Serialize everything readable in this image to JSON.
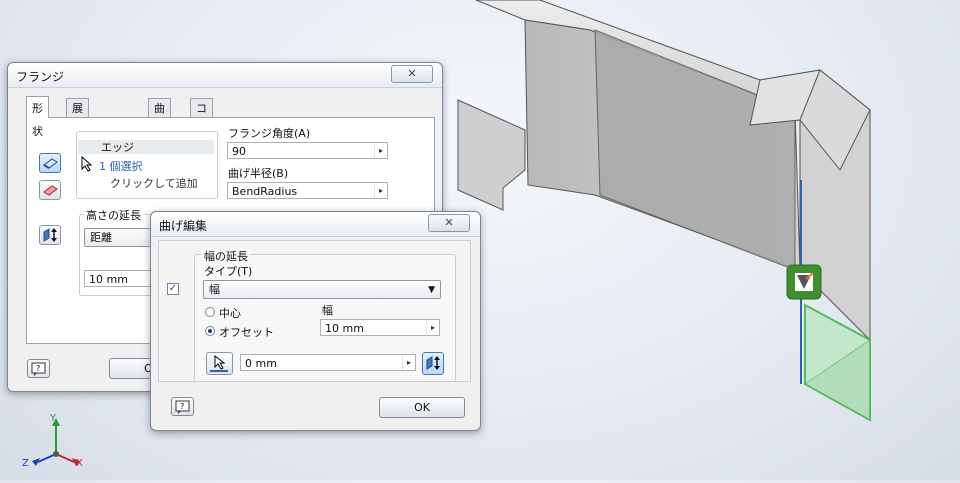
{
  "flange_dialog": {
    "title": "フランジ",
    "close": "✕",
    "tabs": [
      "形状",
      "展開オプション",
      "曲げ",
      "コーナー"
    ],
    "edge_header": "エッジ",
    "edge_selected": "1 個選択",
    "edge_hint": "クリックして追加",
    "angle_label": "フランジ角度(A)",
    "angle_value": "90",
    "radius_label": "曲げ半径(B)",
    "radius_value": "BendRadius",
    "height_extent_label": "高さの延長",
    "height_extent_value": "距離",
    "height_value": "10 mm",
    "ok_partial": "O"
  },
  "bend_dialog": {
    "title": "曲げ編集",
    "close": "✕",
    "width_extent_label": "幅の延長",
    "type_label": "タイプ(T)",
    "type_value": "幅",
    "center_label": "中心",
    "offset_label": "オフセット",
    "width_label": "幅",
    "width_value": "10 mm",
    "offset_value": "0 mm",
    "ok_label": "OK",
    "checkbox_mark": "✓"
  },
  "triad": {
    "x": "X",
    "y": "Y",
    "z": "Z"
  },
  "colors": {
    "accent": "#2b63b0",
    "green": "#3bb54a",
    "model": "#c8c8c8"
  }
}
